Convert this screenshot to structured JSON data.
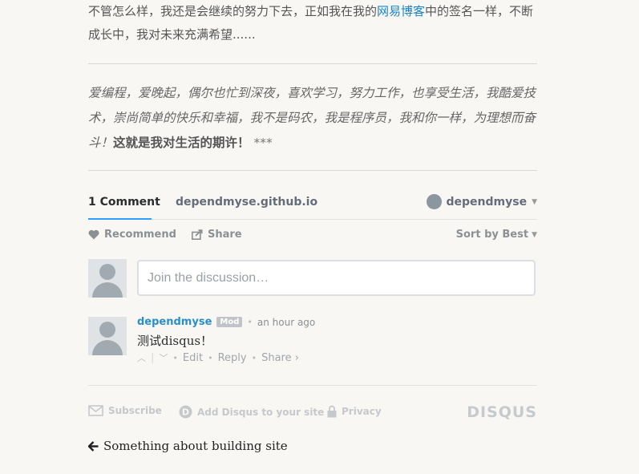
{
  "article": {
    "para_part1": "不管怎么样，我还是会继续的努力下去，正如我在我的",
    "para_link": "网易博客",
    "para_part2": "中的签名一样，不断成长中，我对未来充满希望......",
    "quote_text": "爱编程，爱晚起，偶尔也忙到深夜，喜欢学习，努力工作，也享受生活，我酷爱技术，崇尚简单的快乐和幸福，我不是码农，我是程序员，我和你一样，为理想而奋斗！",
    "quote_bold": "这就是我对生活的期许！",
    "quote_stars": "***"
  },
  "disqus": {
    "comment_count": "1 Comment",
    "site_tab": "dependmyse.github.io",
    "user_menu": "dependmyse",
    "recommend": "Recommend",
    "share": "Share",
    "sort": "Sort by Best",
    "join_placeholder": "Join the discussion…",
    "comments": [
      {
        "author": "dependmyse",
        "badge": "Mod",
        "time": "an hour ago",
        "body": "测试disqus！",
        "edit": "Edit",
        "reply": "Reply",
        "share": "Share ›"
      }
    ],
    "footer": {
      "subscribe": "Subscribe",
      "add_disqus": "Add Disqus to your site",
      "privacy": "Privacy",
      "logo": "DISQUS"
    }
  },
  "nav": {
    "prev_post": "Something about building site"
  },
  "colors": {
    "link": "#1a84c3",
    "tab_accent": "#2e9fff",
    "author": "#2a8fc8"
  },
  "icons": [
    "heart-icon",
    "share-icon",
    "caret-down-icon",
    "upvote-icon",
    "downvote-icon",
    "mail-icon",
    "disqus-d-icon",
    "lock-icon",
    "arrow-left-icon"
  ]
}
